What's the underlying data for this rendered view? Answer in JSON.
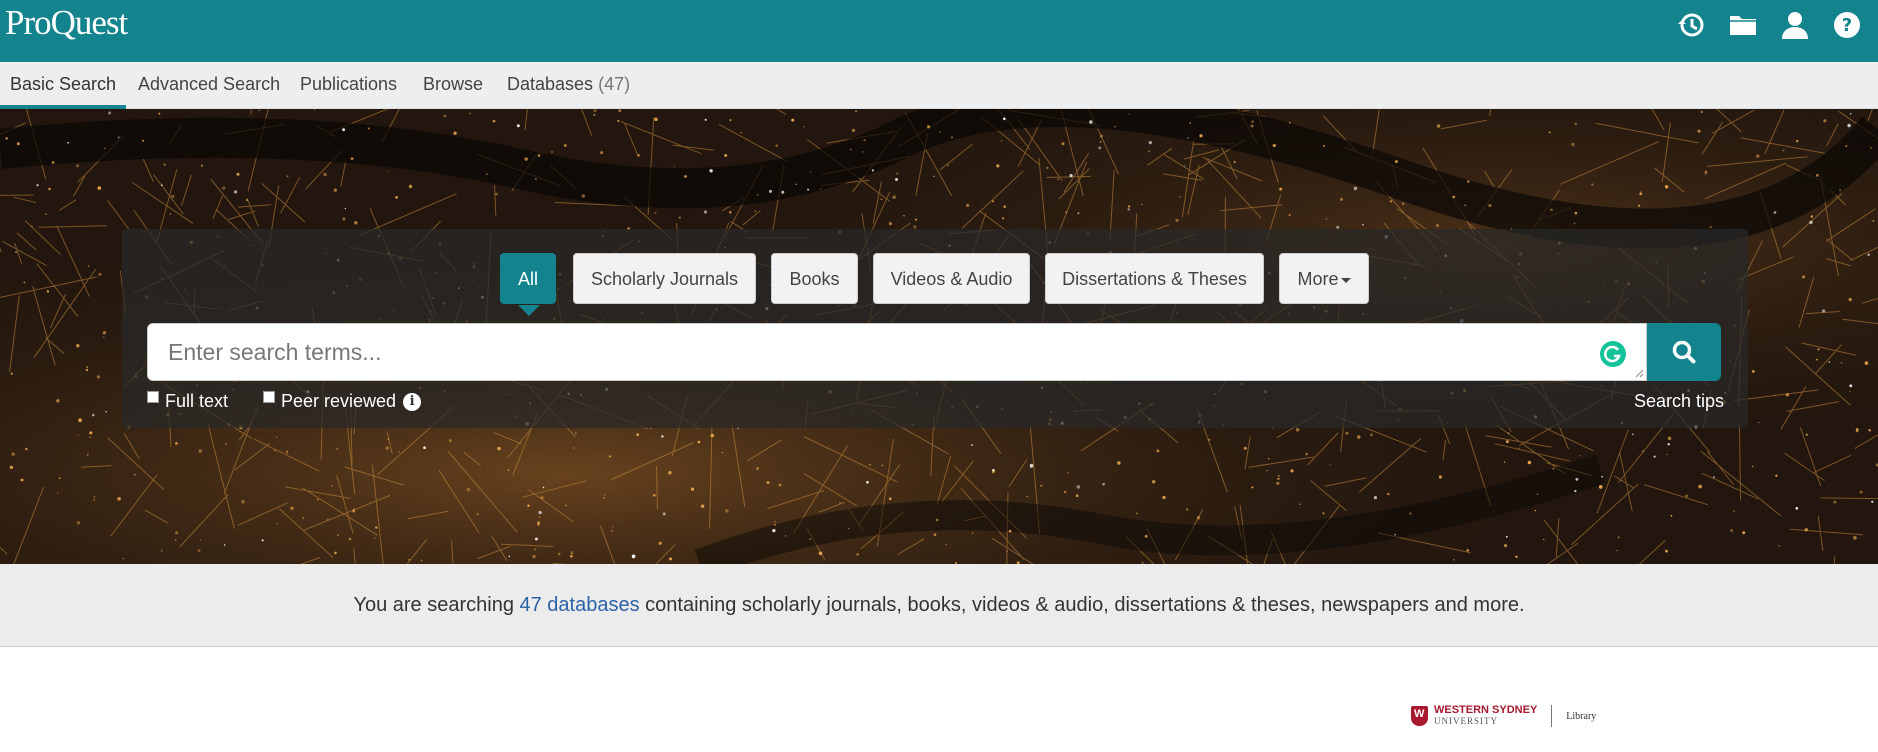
{
  "header": {
    "logo": "ProQuest",
    "icons": [
      "history-icon",
      "folder-icon",
      "user-icon",
      "help-icon"
    ],
    "accent_color": "#13838e"
  },
  "nav": {
    "items": [
      {
        "label": "Basic Search",
        "active": true
      },
      {
        "label": "Advanced Search"
      },
      {
        "label": "Publications"
      },
      {
        "label": "Browse"
      },
      {
        "label": "Databases",
        "count": "(47)"
      }
    ]
  },
  "search": {
    "tabs": [
      {
        "label": "All",
        "active": true
      },
      {
        "label": "Scholarly Journals"
      },
      {
        "label": "Books"
      },
      {
        "label": "Videos & Audio"
      },
      {
        "label": "Dissertations & Theses"
      },
      {
        "label": "More"
      }
    ],
    "placeholder": "Enter search terms...",
    "options": [
      {
        "label": "Full text",
        "checked": false
      },
      {
        "label": "Peer reviewed",
        "checked": false
      }
    ],
    "tips_label": "Search tips"
  },
  "info": {
    "prefix": "You are searching ",
    "link": "47 databases",
    "suffix": " containing scholarly journals, books, videos & audio, dissertations & theses, newspapers and more."
  },
  "footer": {
    "institution_line1": "WESTERN SYDNEY",
    "institution_line2": "UNIVERSITY",
    "library_label": "Library",
    "brand_color": "#a6192e"
  }
}
